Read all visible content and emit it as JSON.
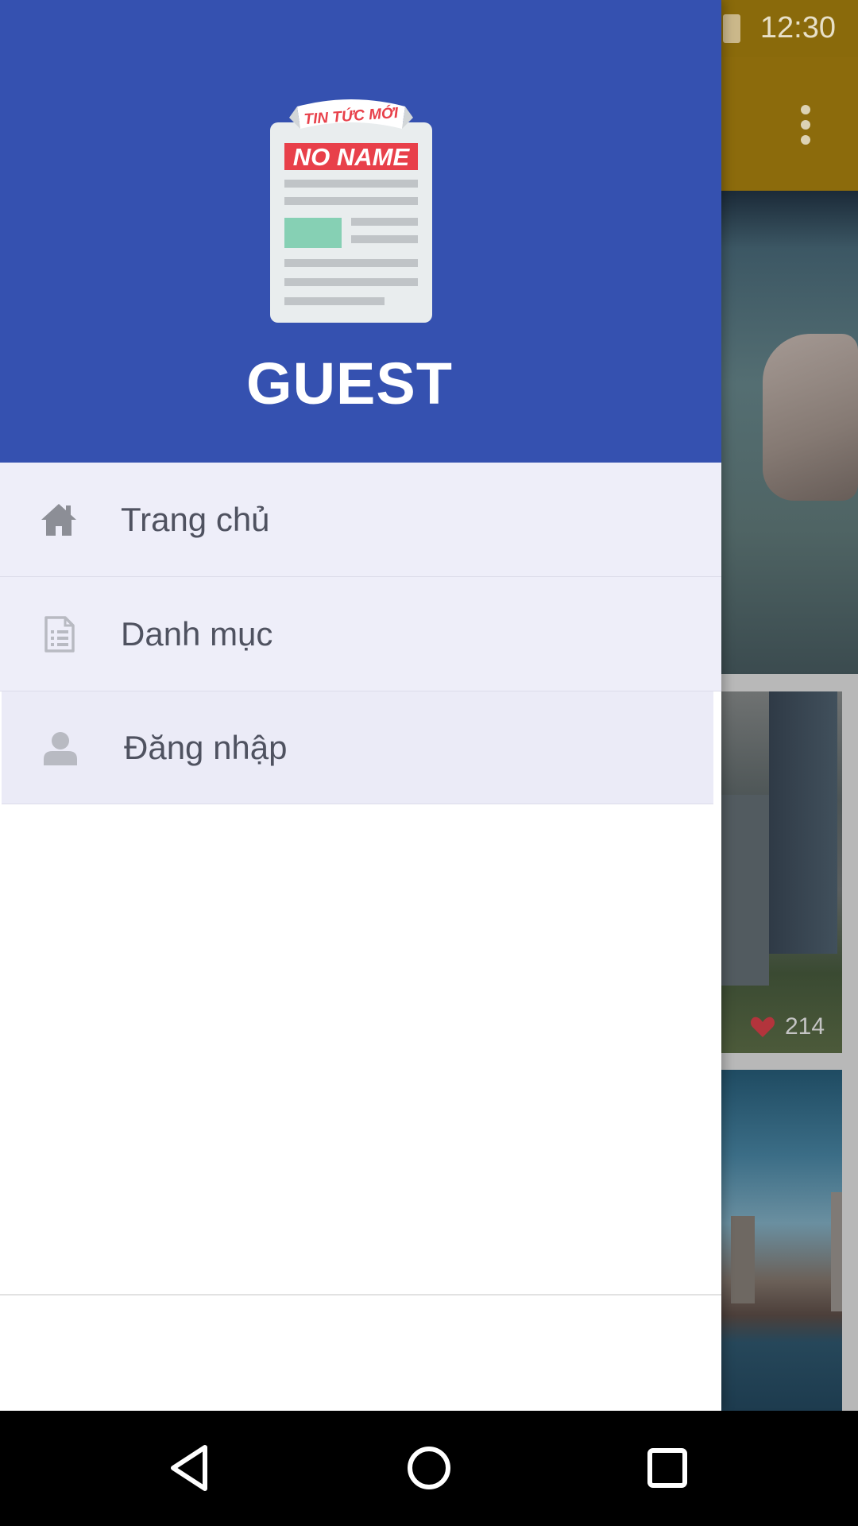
{
  "status_bar": {
    "time": "12:30"
  },
  "drawer": {
    "header": {
      "logo": {
        "banner_text": "TIN TỨC MỚI",
        "title_text": "NO NAME"
      },
      "user_name": "GUEST"
    },
    "menu_items": [
      {
        "label": "Trang chủ",
        "icon": "home-icon"
      },
      {
        "label": "Danh mục",
        "icon": "document-list-icon"
      },
      {
        "label": "Đăng nhập",
        "icon": "person-icon",
        "selected": true
      }
    ]
  },
  "background_feed": {
    "cards": [
      {
        "likes": "214"
      }
    ]
  },
  "colors": {
    "drawer_header": "#3551b0",
    "menu_background": "#eeeef9",
    "toolbar_dimmed": "#8c6b0c",
    "logo_red": "#e8404a",
    "logo_green": "#86d0b4"
  }
}
